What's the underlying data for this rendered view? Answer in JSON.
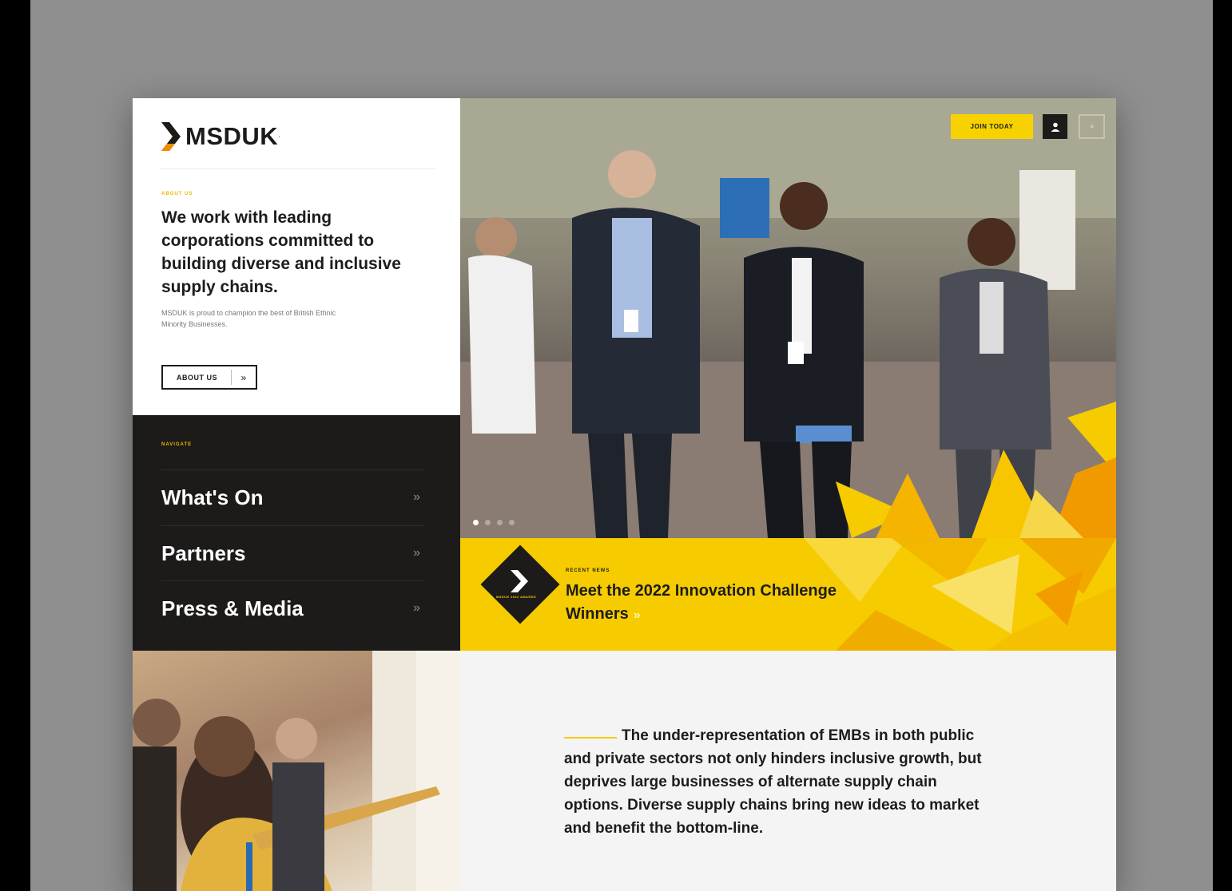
{
  "brand": {
    "name": "MSDUK",
    "mark": "·",
    "accent": "#f6cb00",
    "dark": "#1c1b19"
  },
  "about": {
    "eyebrow": "ABOUT US",
    "headline": "We work with leading corporations committed to building diverse and inclusive supply chains.",
    "subtext": "MSDUK is proud to champion the best of British Ethnic Minority Businesses.",
    "button_label": "ABOUT US",
    "button_icon": "double-chevron-right-icon"
  },
  "nav": {
    "eyebrow": "NAVIGATE",
    "items": [
      {
        "label": "What's On"
      },
      {
        "label": "Partners"
      },
      {
        "label": "Press & Media"
      }
    ]
  },
  "header": {
    "join_label": "JOIN TODAY",
    "user_icon": "user-icon",
    "menu_label": "≡"
  },
  "carousel": {
    "slides": 4,
    "active": 1
  },
  "news": {
    "eyebrow": "RECENT NEWS",
    "badge_text": "MSDUK 2022 AWARDS",
    "headline": "Meet the 2022 Innovation Challenge Winners",
    "arrow": "»"
  },
  "quote": {
    "text": "The under-representation of EMBs in both public and private sectors not only hinders inclusive growth, but deprives large businesses of alternate supply chain options. Diverse supply chains bring new ideas to market and benefit the bottom-line."
  }
}
